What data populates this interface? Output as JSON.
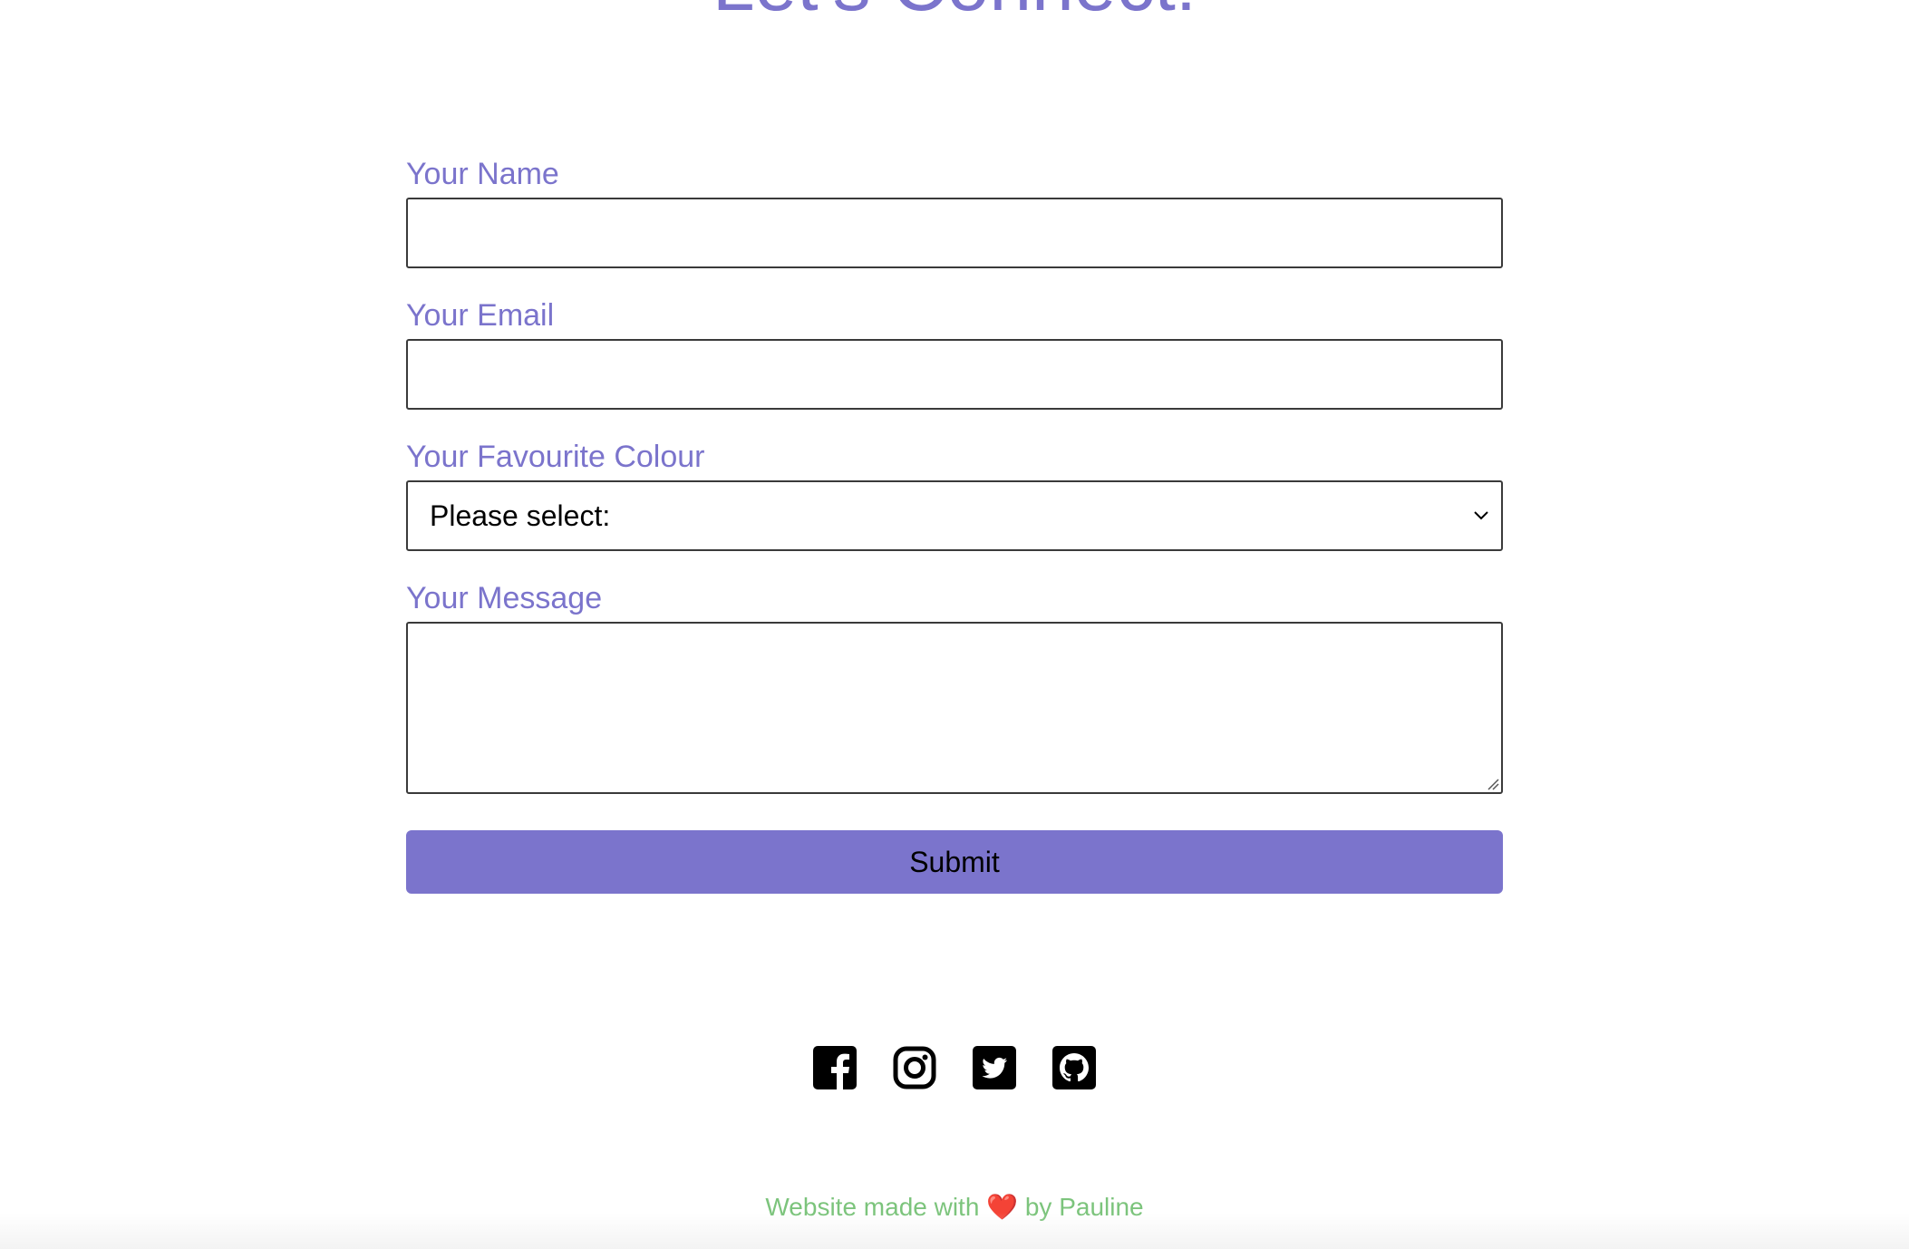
{
  "page": {
    "heading": "Let's Connect!"
  },
  "form": {
    "name_label": "Your Name",
    "name_value": "",
    "email_label": "Your Email",
    "email_value": "",
    "colour_label": "Your Favourite Colour",
    "colour_selected": "Please select:",
    "message_label": "Your Message",
    "message_value": "",
    "submit_label": "Submit"
  },
  "socials": [
    {
      "icon": "facebook-icon"
    },
    {
      "icon": "instagram-icon"
    },
    {
      "icon": "twitter-icon"
    },
    {
      "icon": "github-icon"
    }
  ],
  "footer": {
    "prefix": "Website made with",
    "heart": "❤️",
    "suffix": "by Pauline"
  },
  "colors": {
    "accent": "#7b74cc",
    "footer_text": "#7cc47c"
  }
}
